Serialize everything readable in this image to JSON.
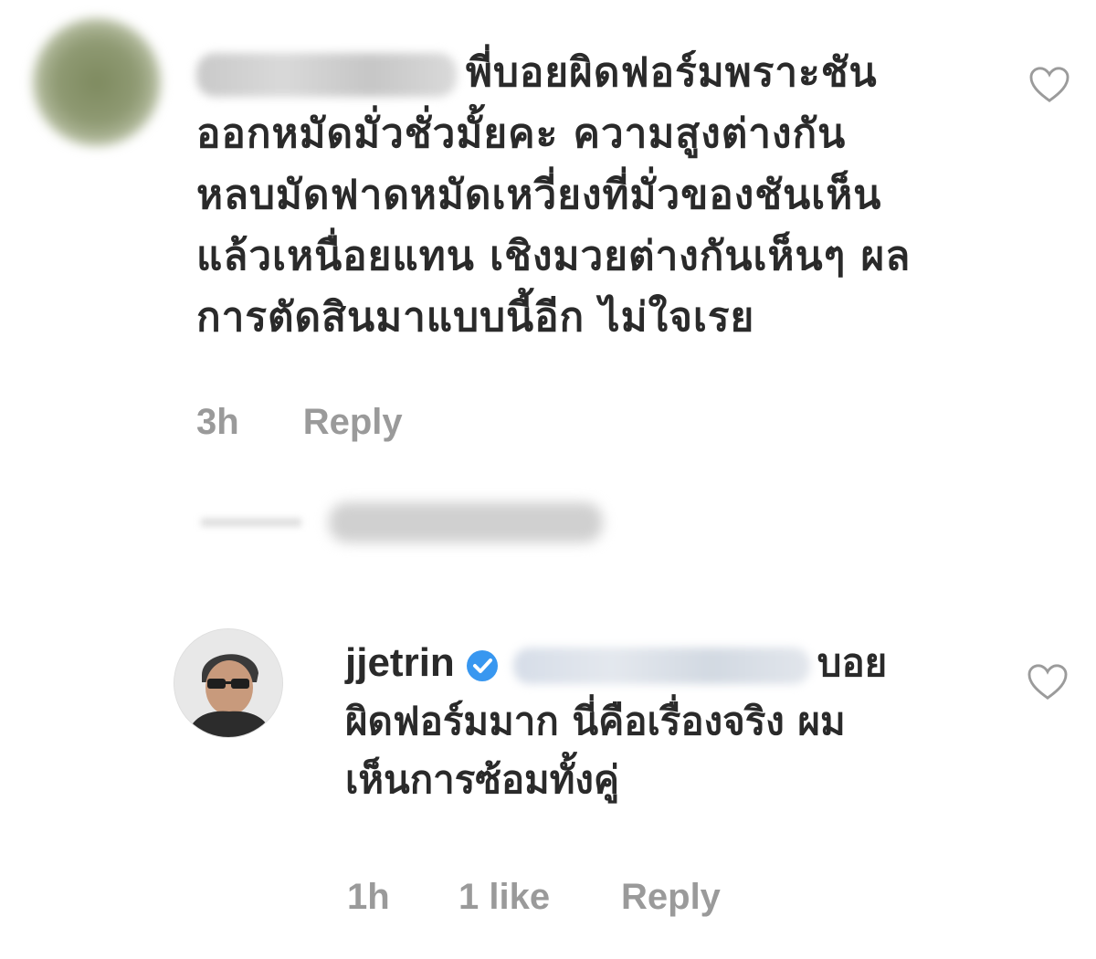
{
  "comment1": {
    "text": "พี่บอยผิดฟอร์มพราะชัน\nออกหมัดมั่วชั่วมั้ยคะ ความสูงต่างกัน\nหลบมัดฟาดหมัดเหวี่ยงที่มั่วของชันเห็น\nแล้วเหนื่อยแทน เชิงมวยต่างกันเห็นๆ ผล\nการตัดสินมาแบบนี้อีก ไม่ใจเรย",
    "time": "3h",
    "reply_label": "Reply"
  },
  "comment2": {
    "username": "jjetrin",
    "first_line_rest": "บอย",
    "text": "ผิดฟอร์มมาก นี่คือเรื่องจริง ผม\nเห็นการซ้อมทั้งคู่",
    "time": "1h",
    "likes": "1 like",
    "reply_label": "Reply"
  },
  "colors": {
    "text": "#2a2a2a",
    "meta": "#9a9a9a",
    "verified": "#3897f0",
    "heart_stroke": "#9b9b9b"
  },
  "icons": {
    "like": "heart-outline-icon",
    "verified": "verified-badge-icon"
  }
}
